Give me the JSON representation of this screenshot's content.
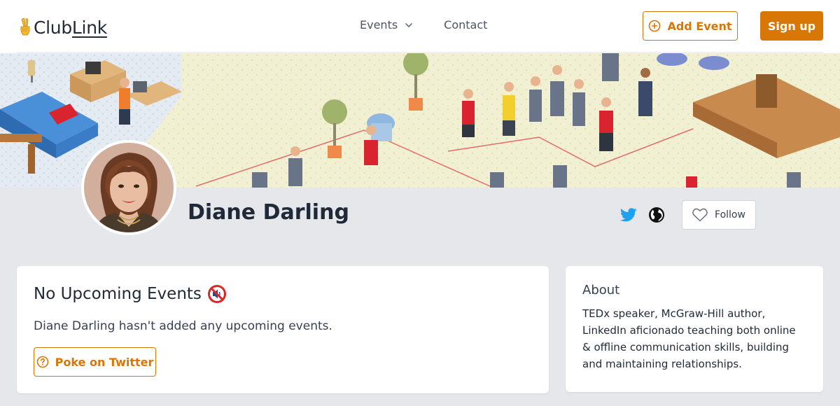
{
  "header": {
    "logo_text_club": "Club",
    "logo_text_link": "Link",
    "logo_icon": "victory-hand-icon",
    "nav": {
      "events_label": "Events",
      "contact_label": "Contact"
    },
    "add_event_label": "Add Event",
    "signup_label": "Sign up"
  },
  "profile": {
    "name": "Diane Darling",
    "follow_label": "Follow",
    "social_icons": [
      "twitter-icon",
      "globe-icon"
    ]
  },
  "events_card": {
    "title": "No Upcoming Events",
    "title_icon": "muted-speaker-icon",
    "description": "Diane Darling hasn't added any upcoming events.",
    "poke_label": "Poke on Twitter"
  },
  "about_card": {
    "title": "About",
    "text": "TEDx speaker, McGraw-Hill author, LinkedIn aficionado teaching both online & offline communication skills, building and maintaining relationships."
  },
  "colors": {
    "accent": "#d97706",
    "page_bg": "#e5e7eb",
    "twitter": "#1da1f2"
  }
}
